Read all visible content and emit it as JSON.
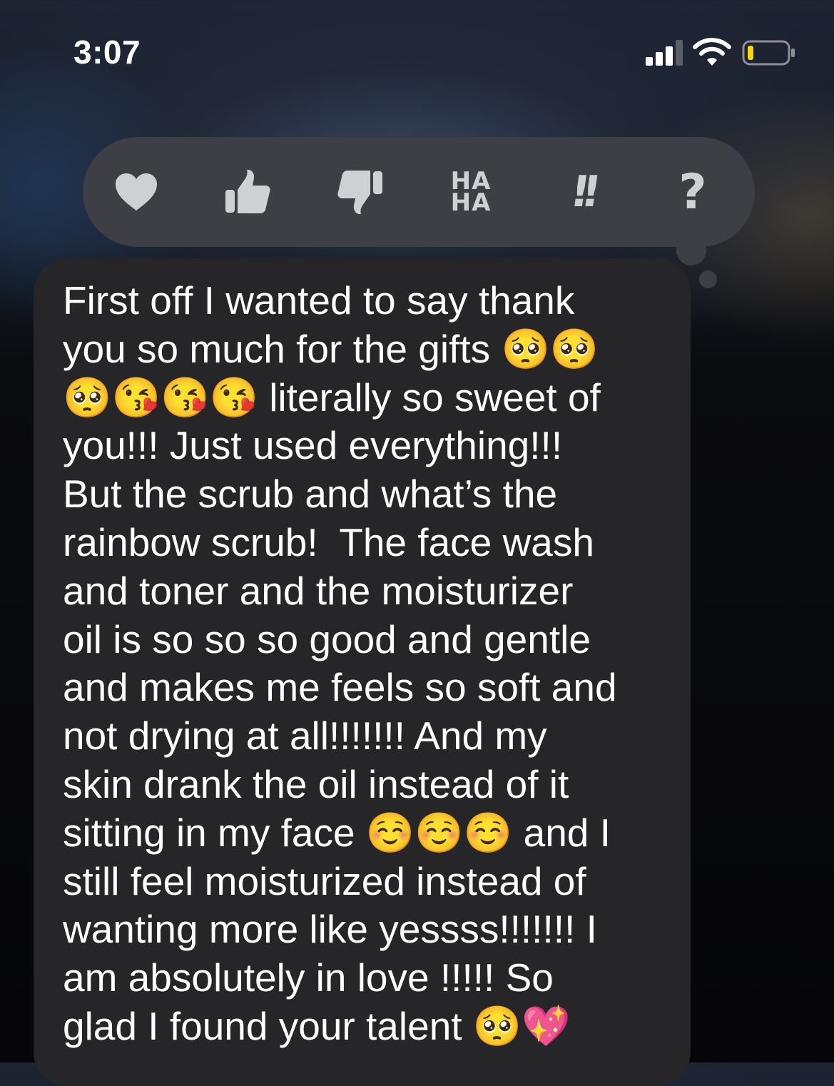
{
  "status_bar": {
    "time": "3:07",
    "icons": [
      "cellular-signal-icon",
      "wifi-icon",
      "battery-low-icon"
    ],
    "battery_color": "#ffd60a"
  },
  "tapback": {
    "reactions": [
      {
        "name": "heart",
        "icon": "heart-icon"
      },
      {
        "name": "thumbs-up",
        "icon": "thumbs-up-icon"
      },
      {
        "name": "thumbs-down",
        "icon": "thumbs-down-icon"
      },
      {
        "name": "haha",
        "icon": "haha-icon",
        "label_top": "HA",
        "label_bottom": "HA"
      },
      {
        "name": "emphasize",
        "icon": "exclamation-icon",
        "label": "!!"
      },
      {
        "name": "question",
        "icon": "question-icon",
        "label": "?"
      }
    ],
    "icon_color": "#cfd0d4",
    "bar_color": "#3e3f44"
  },
  "message": {
    "bubble_color": "#262628",
    "lines": [
      "First off I wanted to say thank",
      "you so much for the gifts 🥺🥺",
      "🥺😘😘😘 literally so sweet of",
      "you!!! Just used everything!!!",
      "But the scrub and what’s the",
      "rainbow scrub!  The face wash",
      "and toner and the moisturizer",
      "oil is so so so good and gentle",
      "and makes me feels so soft and",
      "not drying at all!!!!!!! And my",
      "skin drank the oil instead of it",
      "sitting in my face ☺️☺️☺️ and I",
      "still feel moisturized instead of",
      "wanting more like yessss!!!!!!! I",
      "am absolutely in love !!!!! So",
      "glad I found your talent 🥺💖"
    ]
  }
}
